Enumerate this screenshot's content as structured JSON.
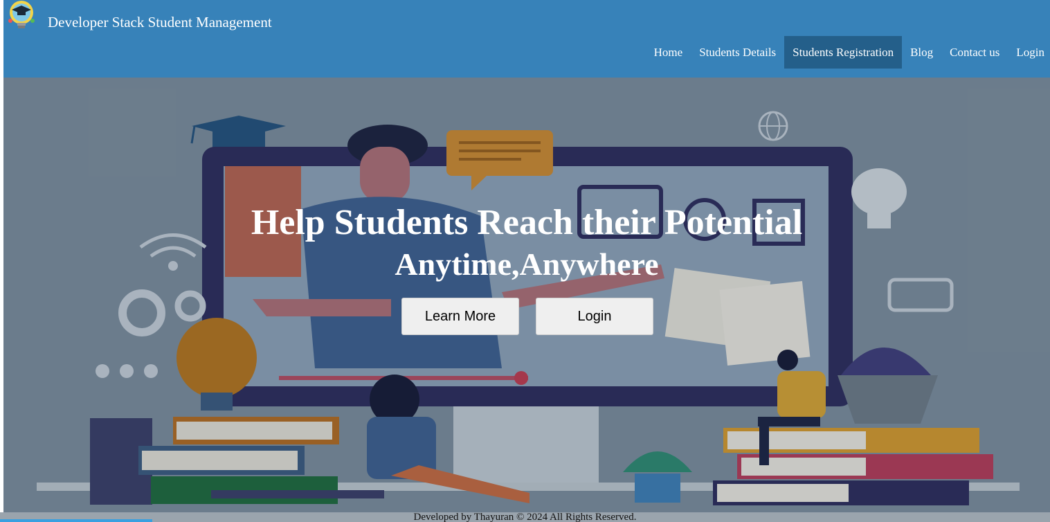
{
  "header": {
    "brand": "Developer Stack Student Management",
    "logo_icon": "graduation-bulb-logo",
    "nav": [
      {
        "label": "Home",
        "active": false
      },
      {
        "label": "Students Details",
        "active": false
      },
      {
        "label": "Students Registration",
        "active": true
      },
      {
        "label": "Blog",
        "active": false
      },
      {
        "label": "Contact us",
        "active": false
      },
      {
        "label": "Login",
        "active": false
      }
    ]
  },
  "hero": {
    "headline": "Help Students Reach their Potential",
    "subheadline": "Anytime,Anywhere",
    "learn_more_label": "Learn More",
    "login_label": "Login",
    "illustration": "online-learning-illustration"
  },
  "footer": {
    "text": "Developed by Thayuran © 2024 All Rights Reserved."
  },
  "colors": {
    "navbar": "#3782b9",
    "nav_active": "#245f8a",
    "hero_bg": "#7d8d9c",
    "button_bg": "#efefef"
  }
}
